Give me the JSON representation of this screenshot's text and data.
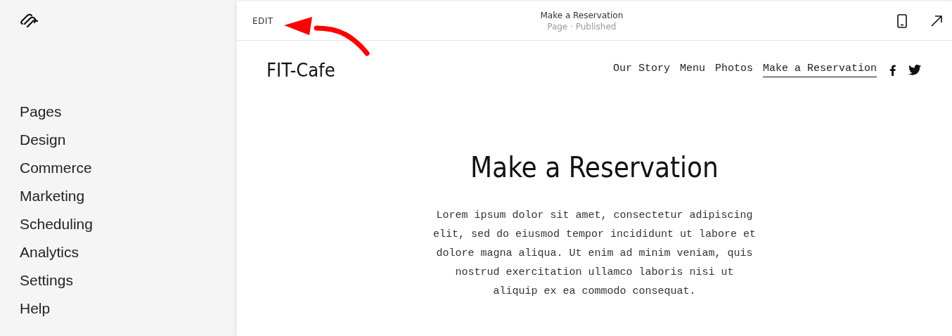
{
  "sidebar": {
    "items": [
      {
        "label": "Pages",
        "selected": false
      },
      {
        "label": "Design",
        "selected": false
      },
      {
        "label": "Commerce",
        "selected": false
      },
      {
        "label": "Marketing",
        "selected": false
      },
      {
        "label": "Scheduling",
        "selected": false
      },
      {
        "label": "Analytics",
        "selected": false
      },
      {
        "label": "Settings",
        "selected": false
      },
      {
        "label": "Help",
        "selected": false
      }
    ]
  },
  "toolbar": {
    "edit": "EDIT",
    "title": "Make a Reservation",
    "subtitle": "Page · Published"
  },
  "site": {
    "logo": "FIT-Cafe",
    "nav": [
      {
        "label": "Our Story",
        "selected": false
      },
      {
        "label": "Menu",
        "selected": false
      },
      {
        "label": "Photos",
        "selected": false
      },
      {
        "label": "Make a Reservation",
        "selected": true
      }
    ],
    "heading": "Make a Reservation",
    "body": "Lorem ipsum dolor sit amet, consectetur adipiscing elit, sed do eiusmod tempor incididunt ut labore et dolore magna aliqua. Ut enim ad minim veniam, quis nostrud exercitation ullamco laboris nisi ut aliquip ex ea commodo consequat."
  }
}
